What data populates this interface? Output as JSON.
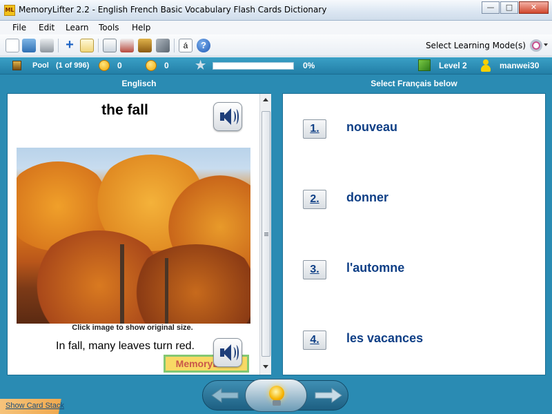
{
  "window": {
    "title": "MemoryLifter 2.2 - English French Basic Vocabulary Flash Cards Dictionary",
    "icon_text": "ML",
    "minimize": "—",
    "maximize": "□",
    "close": "✕"
  },
  "menu": [
    "File",
    "Edit",
    "Learn",
    "Tools",
    "Help"
  ],
  "toolbar": {
    "icons": [
      "new-document-icon",
      "open-folder-icon",
      "print-icon",
      "add-card-icon",
      "edit-card-icon",
      "presentation-icon",
      "slideshow-icon",
      "card-box-icon",
      "settings-tools-icon",
      "special-char-icon",
      "help-icon"
    ],
    "special_char": "á",
    "help": "?",
    "mode_label": "Select Learning Mode(s)"
  },
  "status": {
    "pool_label": "Pool",
    "pool_count": "(1 of 996)",
    "correct": "0",
    "wrong": "0",
    "progress_fraction": 0.0,
    "progress_text": "0%",
    "level": "Level 2",
    "user": "manwei30"
  },
  "question": {
    "header": "Englisch",
    "word": "the fall",
    "image_caption": "Click image to show original size.",
    "example": "In fall, many leaves turn red.",
    "logo_text": "MemoryLifter"
  },
  "answers": {
    "header": "Select Français below",
    "choices": [
      {
        "num": "1.",
        "text": "nouveau"
      },
      {
        "num": "2.",
        "text": "donner"
      },
      {
        "num": "3.",
        "text": "l'automne"
      },
      {
        "num": "4.",
        "text": "les vacances"
      }
    ]
  },
  "footer": {
    "show_stack": "Show Card Stack"
  }
}
